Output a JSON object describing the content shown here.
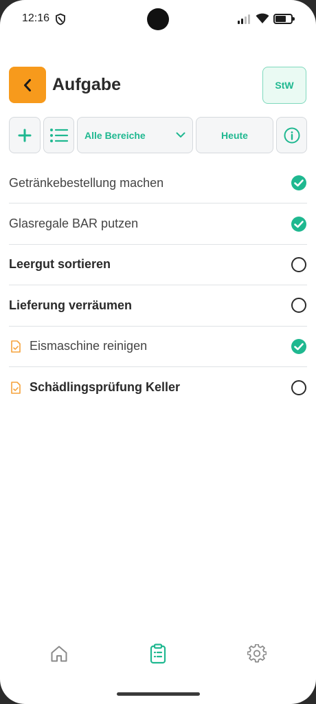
{
  "status_bar": {
    "time": "12:16"
  },
  "header": {
    "title": "Aufgabe",
    "user_initials": "StW"
  },
  "toolbar": {
    "area_select": "Alle Bereiche",
    "date_filter": "Heute"
  },
  "tasks": [
    {
      "label": "Getränkebestellung machen",
      "done": true,
      "has_doc": false
    },
    {
      "label": "Glasregale BAR putzen",
      "done": true,
      "has_doc": false
    },
    {
      "label": "Leergut sortieren",
      "done": false,
      "has_doc": false
    },
    {
      "label": "Lieferung verräumen",
      "done": false,
      "has_doc": false
    },
    {
      "label": "Eismaschine reinigen",
      "done": true,
      "has_doc": true
    },
    {
      "label": "Schädlingsprüfung Keller",
      "done": false,
      "has_doc": true
    }
  ],
  "nav": {
    "active": "tasks"
  },
  "colors": {
    "accent": "#1fb890",
    "back_button": "#f79a1c",
    "doc_icon": "#f5a23a"
  }
}
